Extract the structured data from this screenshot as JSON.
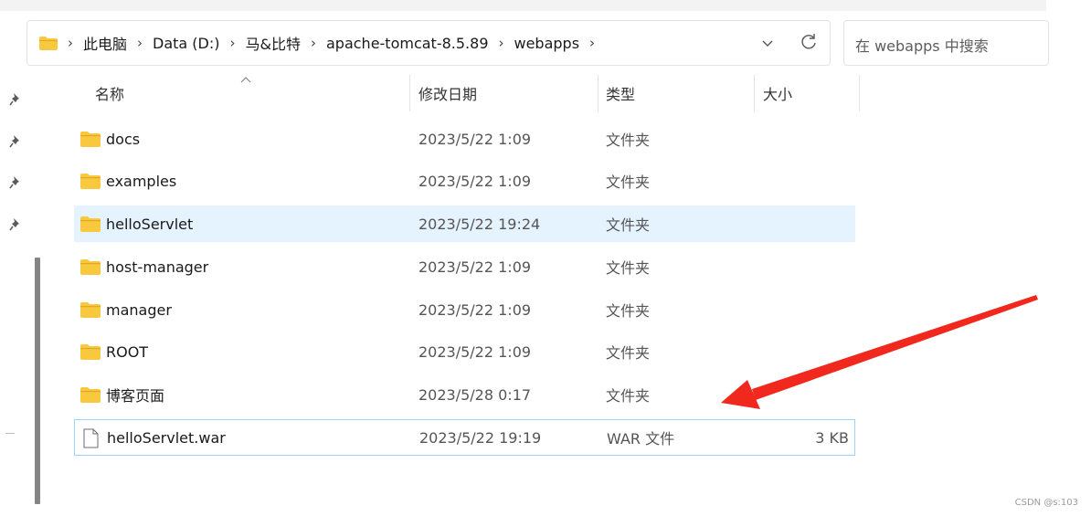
{
  "address_bar": {
    "breadcrumbs": [
      "此电脑",
      "Data (D:)",
      "马&比特",
      "apache-tomcat-8.5.89",
      "webapps"
    ],
    "separator": "›"
  },
  "search": {
    "placeholder": "在 webapps 中搜索"
  },
  "columns": {
    "name": "名称",
    "date": "修改日期",
    "type": "类型",
    "size": "大小"
  },
  "files": [
    {
      "name": "docs",
      "date": "2023/5/22 1:09",
      "type": "文件夹",
      "size": "",
      "icon": "folder-icon"
    },
    {
      "name": "examples",
      "date": "2023/5/22 1:09",
      "type": "文件夹",
      "size": "",
      "icon": "folder-icon"
    },
    {
      "name": "helloServlet",
      "date": "2023/5/22 19:24",
      "type": "文件夹",
      "size": "",
      "icon": "folder-icon",
      "selected": true
    },
    {
      "name": "host-manager",
      "date": "2023/5/22 1:09",
      "type": "文件夹",
      "size": "",
      "icon": "folder-icon"
    },
    {
      "name": "manager",
      "date": "2023/5/22 1:09",
      "type": "文件夹",
      "size": "",
      "icon": "folder-icon"
    },
    {
      "name": "ROOT",
      "date": "2023/5/22 1:09",
      "type": "文件夹",
      "size": "",
      "icon": "folder-icon"
    },
    {
      "name": "博客页面",
      "date": "2023/5/28 0:17",
      "type": "文件夹",
      "size": "",
      "icon": "folder-icon"
    },
    {
      "name": "helloServlet.war",
      "date": "2023/5/22 19:19",
      "type": "WAR 文件",
      "size": "3 KB",
      "icon": "file-icon",
      "focused": true
    }
  ],
  "colors": {
    "folder": "#f8c93f",
    "folder_dark": "#e0a823",
    "selection": "#e5f3ff",
    "focus_border": "#99d1ff",
    "annotation_arrow": "#f0281e"
  },
  "watermark": "CSDN @s:103"
}
